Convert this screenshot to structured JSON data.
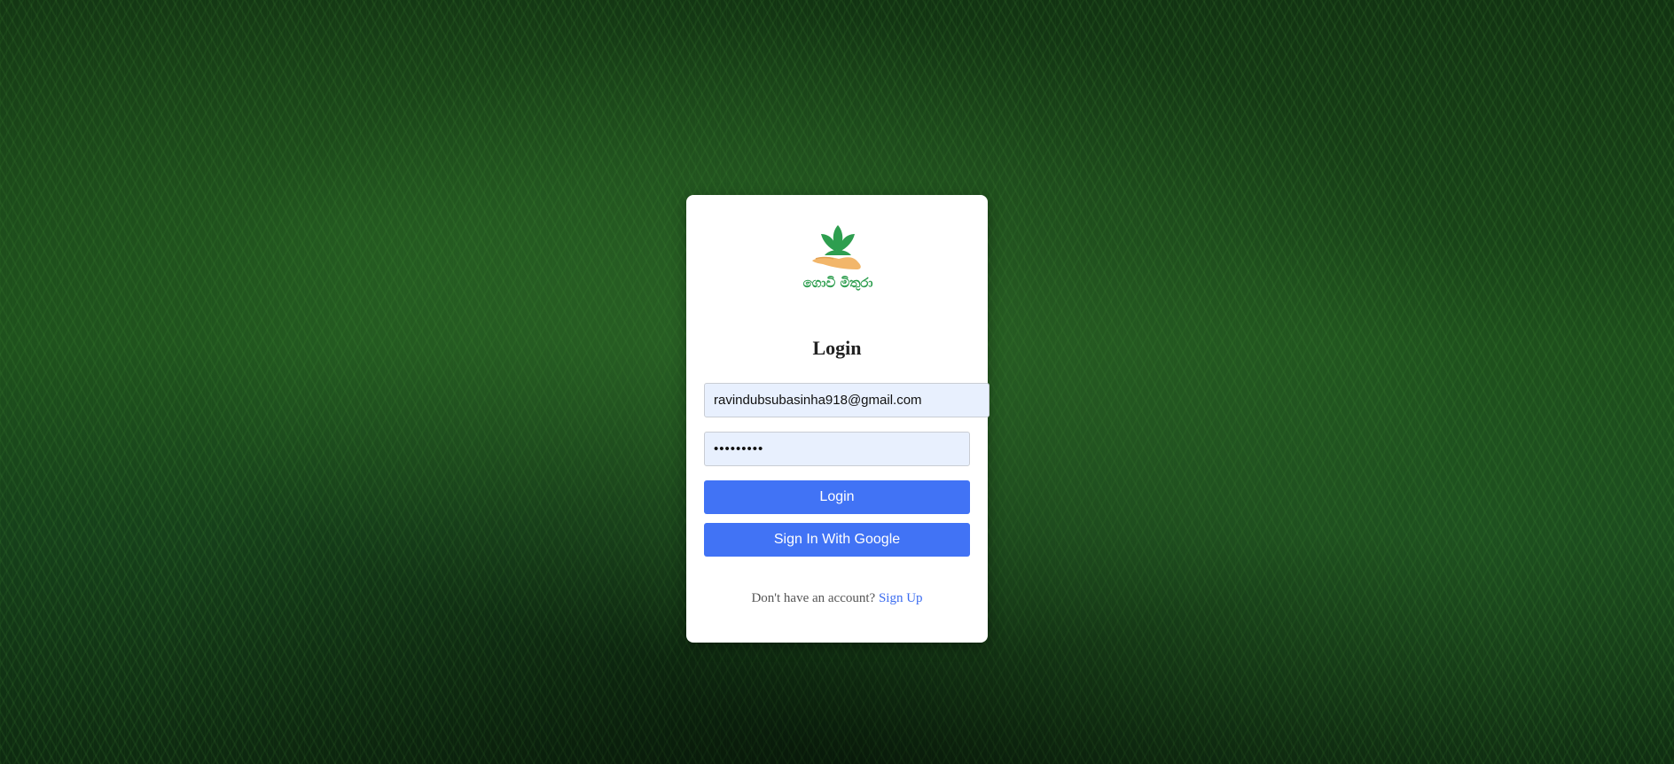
{
  "background": {
    "icon": "grass-texture"
  },
  "brand": {
    "logo_icon": "hand-holding-sprout-icon",
    "logo_text": "ගොවි මිතුරා",
    "leaf_color": "#2e9e4f",
    "hand_color": "#f2b66a"
  },
  "login_form": {
    "title": "Login",
    "email_value": "ravindubsubasinha918@gmail.com",
    "password_value": "password1",
    "login_button_label": "Login",
    "google_button_label": "Sign In With Google",
    "signup_prompt": "Don't have an account?",
    "signup_link_label": "Sign Up"
  },
  "colors": {
    "button": "#4173f5",
    "input_fill": "#e8f0fe",
    "link": "#3b6cf0"
  }
}
